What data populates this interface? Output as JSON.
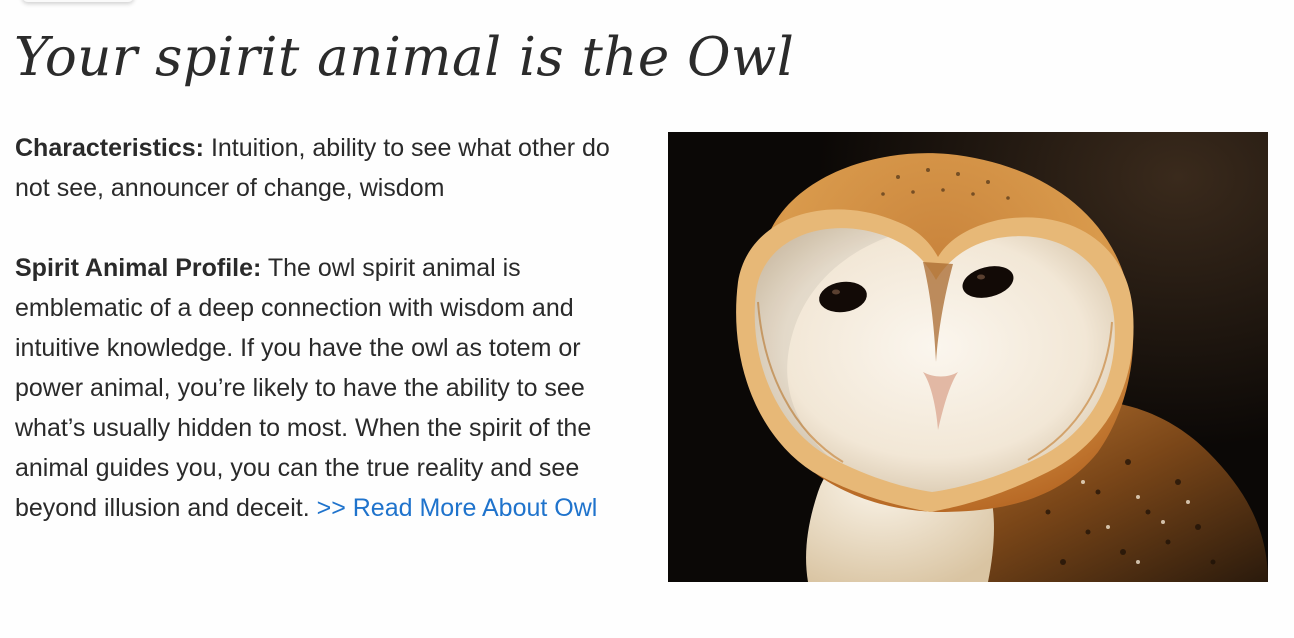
{
  "page": {
    "title": "Your spirit animal is the Owl"
  },
  "characteristics": {
    "label": "Characteristics:",
    "text": "Intuition, ability to see what other do not see, announcer of change, wisdom"
  },
  "profile": {
    "label": "Spirit Animal Profile:",
    "text": "The owl spirit animal is emblematic of a deep connection with wisdom and intuitive knowledge. If you have the owl as totem or power animal, you’re likely to have the ability to see what’s usually hidden to most. When the spirit of the animal guides you, you can the true reality and see beyond illusion and deceit.",
    "read_more": ">> Read More About Owl"
  },
  "image": {
    "subject": "barn-owl-photo",
    "background_color": "#0b0806"
  },
  "colors": {
    "text": "#2a2a2a",
    "link": "#1f73cc"
  }
}
